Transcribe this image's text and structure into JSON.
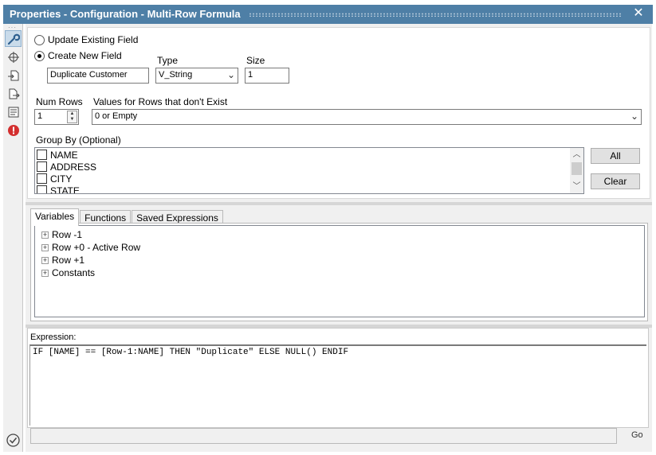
{
  "window": {
    "title": "Properties - Configuration - Multi-Row Formula"
  },
  "toolbar": {
    "icons": [
      "wrench-icon",
      "crosshair-icon",
      "input-arrow-icon",
      "output-file-icon",
      "annotation-icon",
      "error-icon"
    ]
  },
  "output": {
    "update_existing_label": "Update Existing Field",
    "create_new_label": "Create New  Field",
    "selected_mode": "create_new",
    "field_name_value": "Duplicate Customer",
    "type_label": "Type",
    "type_value": "V_String",
    "size_label": "Size",
    "size_value": "1"
  },
  "rows": {
    "num_rows_label": "Num Rows",
    "num_rows_value": "1",
    "nonexist_label": "Values for Rows that don't Exist",
    "nonexist_value": "0 or Empty"
  },
  "group_by": {
    "label": "Group By (Optional)",
    "items": [
      {
        "label": "NAME",
        "checked": false
      },
      {
        "label": "ADDRESS",
        "checked": false
      },
      {
        "label": "CITY",
        "checked": false
      },
      {
        "label": "STATE",
        "checked": false
      }
    ],
    "all_button": "All",
    "clear_button": "Clear"
  },
  "tabs": [
    {
      "label": "Variables",
      "active": true
    },
    {
      "label": "Functions",
      "active": false
    },
    {
      "label": "Saved Expressions",
      "active": false
    }
  ],
  "variables_tree": [
    {
      "label": "Row -1"
    },
    {
      "label": "Row +0 - Active Row"
    },
    {
      "label": "Row +1"
    },
    {
      "label": "Constants"
    }
  ],
  "expression": {
    "label": "Expression:",
    "text": "IF [NAME] == [Row-1:NAME] THEN \"Duplicate\" ELSE NULL() ENDIF"
  },
  "footer": {
    "go_label": "Go"
  },
  "colors": {
    "titlebar": "#4e7fa6",
    "error_red": "#d32f2f",
    "accent_blue": "#3a6ea5"
  }
}
